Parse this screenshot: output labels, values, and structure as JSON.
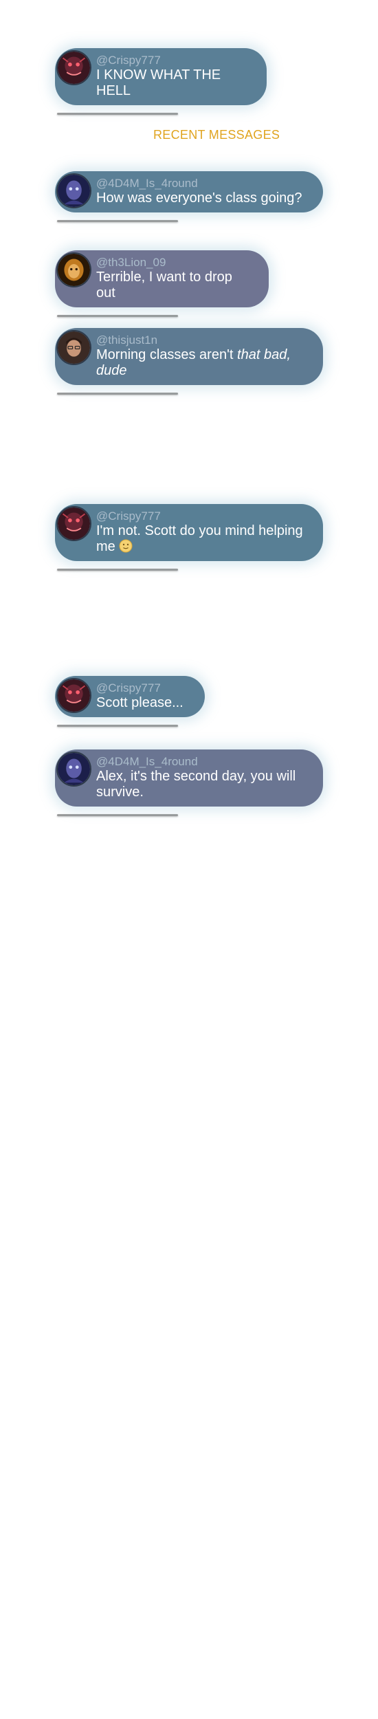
{
  "section_title": "RECENT MESSAGES",
  "pinned_message": {
    "user": "@Crispy777",
    "text": "I KNOW WHAT THE HELL",
    "avatar": "crispy-avatar-icon"
  },
  "messages": [
    {
      "user": "@4D4M_Is_4round",
      "text": "How was everyone's class going?",
      "avatar": "adam-avatar-icon"
    },
    {
      "user": "@th3Lion_09",
      "text": "Terrible, I want to drop out",
      "avatar": "lion-avatar-icon"
    },
    {
      "user": "@thisjust1n",
      "text_plain": "Morning classes aren't ",
      "text_italic": "that bad, dude",
      "avatar": "justin-avatar-icon"
    },
    {
      "user": "@Crispy777",
      "text": "I'm not. Scott do you mind helping me",
      "emoji": "slightly-smiling-face-emoji",
      "avatar": "crispy-avatar-icon"
    },
    {
      "user": "@Crispy777",
      "text": "Scott please...",
      "avatar": "crispy-avatar-icon"
    },
    {
      "user": "@4D4M_Is_4round",
      "text": "Alex, it's the second day, you will survive.",
      "avatar": "adam-avatar-icon"
    }
  ],
  "colors": {
    "bubble_teal": "#5a7f96",
    "bubble_purple": "#6f7492",
    "handle": "#aabccb",
    "section_title": "#e0a420",
    "underline": "#9a9a9a"
  }
}
